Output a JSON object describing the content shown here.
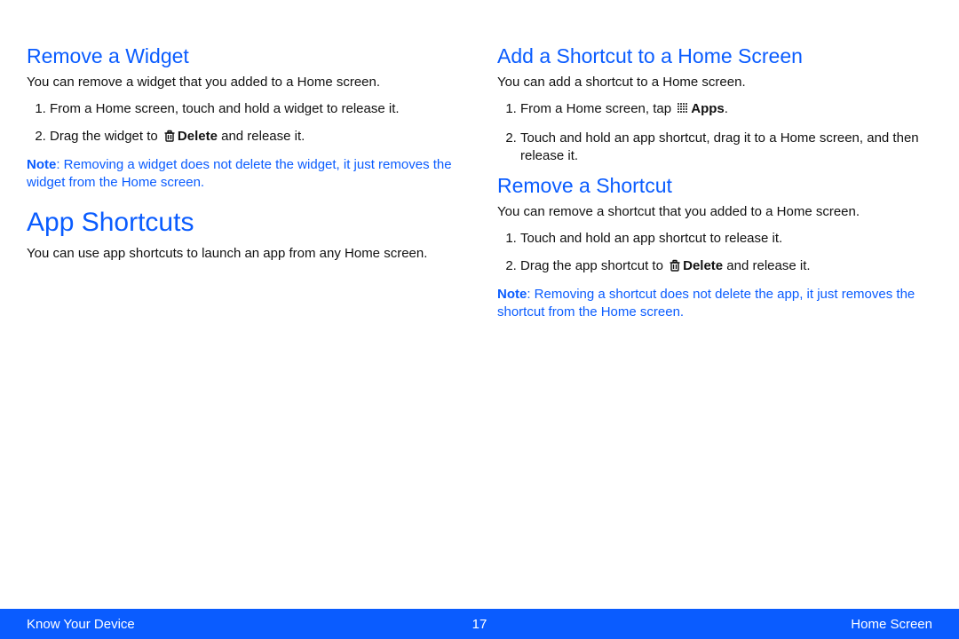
{
  "left": {
    "removeWidget": {
      "heading": "Remove a Widget",
      "intro": "You can remove a widget that you added to a Home screen.",
      "step1": "From a Home screen, touch and hold a widget to release it.",
      "step2a": "Drag the widget to ",
      "step2_delete": "Delete",
      "step2b": "  and release it.",
      "noteLabel": "Note",
      "noteText": ": Removing a widget does not delete the widget, it just removes the widget from the Home screen."
    },
    "appShortcuts": {
      "heading": "App Shortcuts",
      "intro": "You can use app shortcuts to launch an app from any Home screen."
    }
  },
  "right": {
    "addShortcut": {
      "heading": "Add a Shortcut to a Home Screen",
      "intro": "You can add a shortcut to a Home screen.",
      "step1a": "From a Home screen, tap ",
      "step1_apps": "Apps",
      "step1b": ".",
      "step2": "Touch and hold an app shortcut, drag it to a Home screen, and then release it."
    },
    "removeShortcut": {
      "heading": "Remove a Shortcut",
      "intro": "You can remove a shortcut that you added to a Home screen.",
      "step1": "Touch and hold an app shortcut to release it.",
      "step2a": "Drag the app shortcut to ",
      "step2_delete": "Delete",
      "step2b": "  and release it.",
      "noteLabel": "Note",
      "noteText": ": Removing a shortcut does not delete the app, it just removes the shortcut from the Home screen."
    }
  },
  "footer": {
    "left": "Know Your Device",
    "center": "17",
    "right": "Home Screen"
  }
}
